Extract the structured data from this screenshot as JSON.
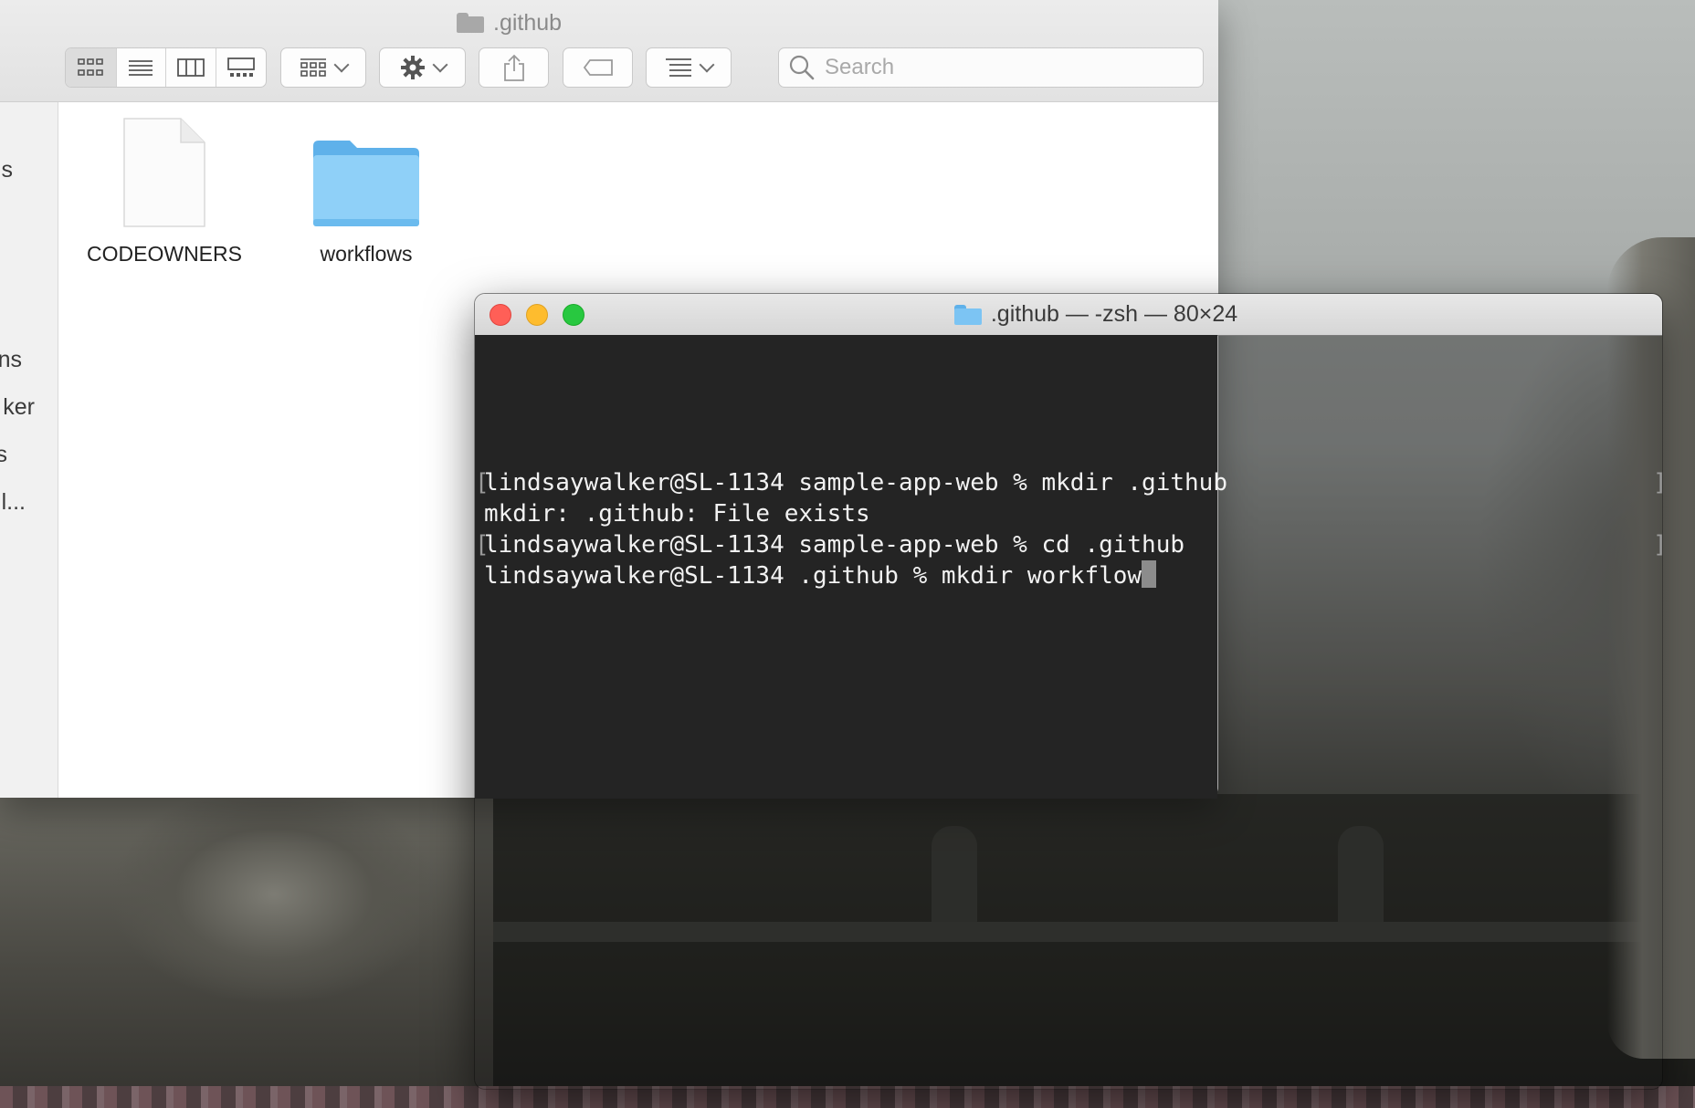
{
  "finder": {
    "title": ".github",
    "search_placeholder": "Search",
    "sidebar_fragments": [
      "s",
      "ns",
      "ker",
      "s",
      "l..."
    ],
    "items": [
      {
        "name": "CODEOWNERS",
        "kind": "document-icon"
      },
      {
        "name": "workflows",
        "kind": "folder-icon"
      }
    ]
  },
  "terminal": {
    "title": ".github — -zsh — 80×24",
    "lines": [
      "lindsaywalker@SL-1134 sample-app-web % mkdir .github",
      "mkdir: .github: File exists",
      "lindsaywalker@SL-1134 sample-app-web % cd .github",
      "lindsaywalker@SL-1134 .github % mkdir workflow"
    ]
  },
  "colors": {
    "close": "#ff5f57",
    "minimize": "#febc2e",
    "zoom": "#28c840",
    "terminal_bg": "#242424",
    "folder_blue": "#7cc4f3"
  }
}
